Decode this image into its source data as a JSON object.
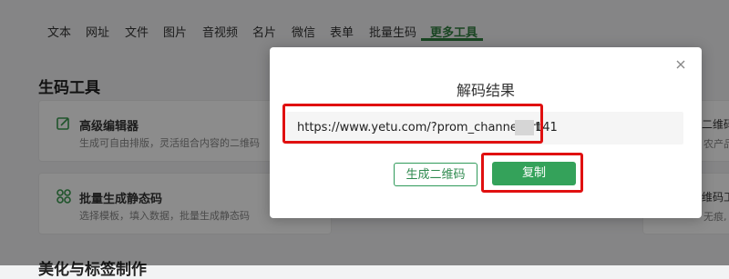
{
  "nav": {
    "tabs": [
      "文本",
      "网址",
      "文件",
      "图片",
      "音视频",
      "名片",
      "微信",
      "表单",
      "批量生码",
      "更多工具"
    ],
    "active_tab": "更多工具"
  },
  "sections": {
    "generate_tools_title": "生码工具",
    "beautify_title": "美化与标签制作"
  },
  "cards": [
    {
      "title": "高级编辑器",
      "desc": "生成可自由排版，灵活组合内容的二维码",
      "icon": "edit-icon"
    },
    {
      "title": "批量生成静态码",
      "desc": "选择模板，填入数据，批量生成静态码",
      "icon": "grid-icon"
    }
  ],
  "right_snippets": {
    "card1_title": "二维码",
    "card1_desc": "农产品",
    "card2_title": "维码工",
    "card2_desc": "无痕,"
  },
  "modal": {
    "title": "解码结果",
    "result_text": "https://www.yetu.com/?prom_channel=rt",
    "result_tail": "141",
    "generate_button": "生成二维码",
    "copy_button": "复制",
    "close_icon": "close-icon"
  },
  "colors": {
    "brand_green": "#34a25a",
    "highlight_red": "#e01010"
  }
}
